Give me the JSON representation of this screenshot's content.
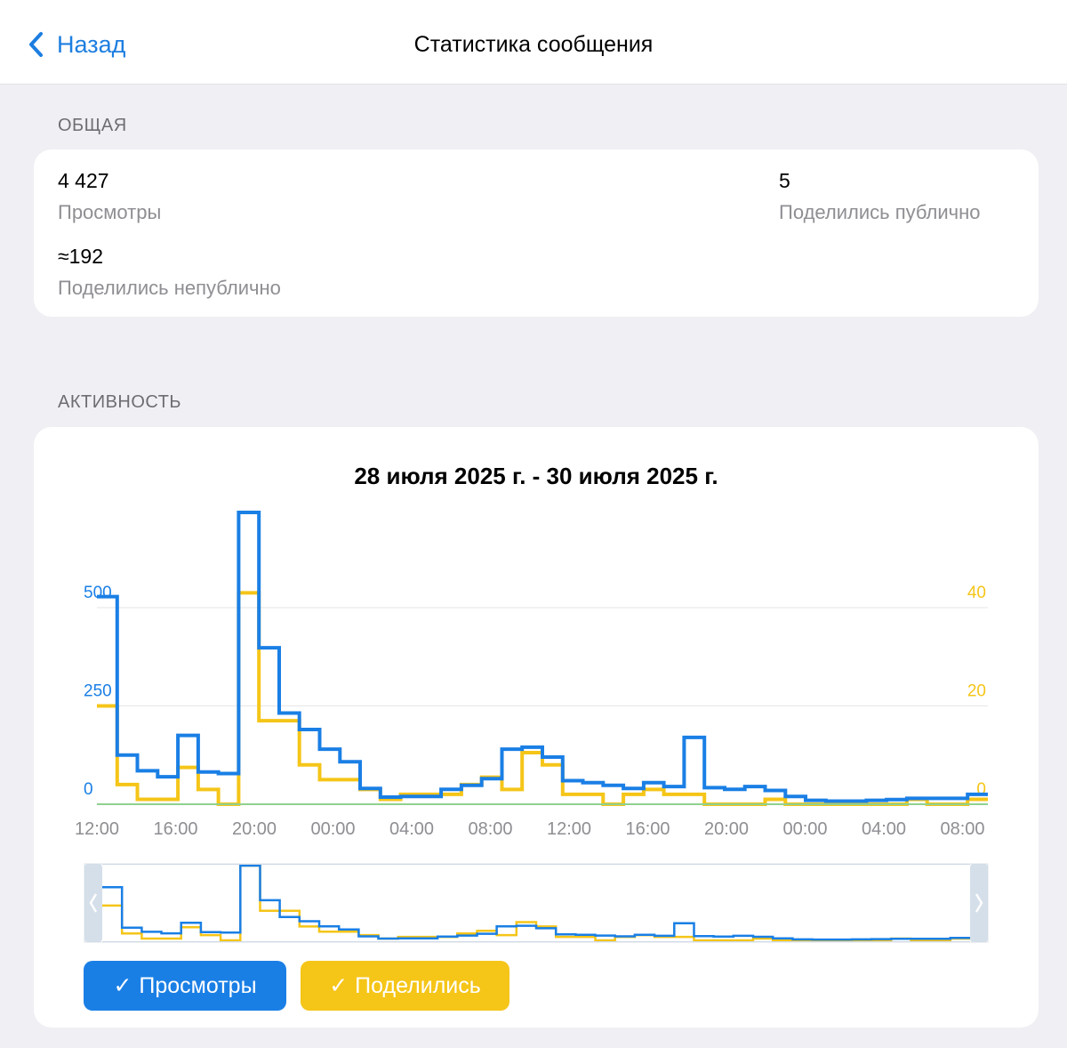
{
  "nav": {
    "back_label": "Назад",
    "title": "Статистика сообщения"
  },
  "overview": {
    "header": "ОБЩАЯ",
    "views_value": "4 427",
    "views_label": "Просмотры",
    "public_shares_value": "5",
    "public_shares_label": "Поделились публично",
    "private_shares_value": "≈192",
    "private_shares_label": "Поделились непублично"
  },
  "activity": {
    "header": "АКТИВНОСТЬ",
    "toggle_views_label": "Просмотры",
    "toggle_shares_label": "Поделились",
    "check_glyph": "✓"
  },
  "colors": {
    "views": "#1a7fe5",
    "shares": "#f5c518",
    "zero_line": "#8fd18f",
    "grid": "#e6e6e6"
  },
  "chart_data": {
    "type": "line",
    "step": true,
    "title": "28 июля 2025 г. - 30 июля 2025 г.",
    "x_tick_labels": [
      "12:00",
      "16:00",
      "20:00",
      "00:00",
      "04:00",
      "08:00",
      "12:00",
      "16:00",
      "20:00",
      "00:00",
      "04:00",
      "08:00"
    ],
    "y_left": {
      "ticks": [
        0,
        250,
        500
      ],
      "range": [
        0,
        500
      ]
    },
    "y_right": {
      "ticks": [
        0,
        20,
        40
      ],
      "range": [
        0,
        40
      ]
    },
    "grid": true,
    "bucket_hours": 1,
    "series": [
      {
        "name": "Просмотры",
        "axis": "left",
        "values": [
          528,
          125,
          85,
          70,
          175,
          82,
          78,
          742,
          398,
          232,
          190,
          140,
          108,
          40,
          18,
          20,
          20,
          38,
          48,
          65,
          140,
          145,
          120,
          60,
          55,
          48,
          40,
          55,
          45,
          170,
          42,
          38,
          45,
          35,
          20,
          10,
          8,
          8,
          10,
          12,
          15,
          15,
          15,
          25
        ]
      },
      {
        "name": "Поделились",
        "axis": "right",
        "values": [
          20,
          4,
          1,
          1,
          7.5,
          3,
          0,
          43,
          17,
          17,
          8,
          5,
          5,
          3,
          1,
          2,
          2,
          2,
          4,
          5.5,
          3,
          10.5,
          8,
          2,
          2,
          0,
          2,
          3,
          2,
          2,
          0,
          0,
          0,
          1,
          0,
          0,
          0,
          0,
          0,
          0,
          1,
          0,
          0,
          1
        ]
      }
    ]
  }
}
